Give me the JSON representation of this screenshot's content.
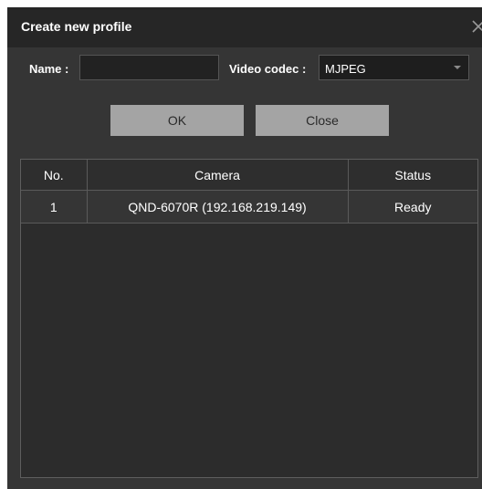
{
  "dialog": {
    "title": "Create new profile",
    "close_icon": "close-icon"
  },
  "form": {
    "name_label": "Name :",
    "name_value": "",
    "name_placeholder": "",
    "codec_label": "Video codec :",
    "codec_value": "MJPEG"
  },
  "buttons": {
    "ok_label": "OK",
    "close_label": "Close"
  },
  "table": {
    "columns": [
      "No.",
      "Camera",
      "Status"
    ],
    "rows": [
      {
        "no": "1",
        "camera": "QND-6070R (192.168.219.149)",
        "status": "Ready"
      }
    ]
  },
  "colors": {
    "dialog_bg": "#353535",
    "titlebar_bg": "#262626",
    "button_bg": "#a4a4a4"
  }
}
